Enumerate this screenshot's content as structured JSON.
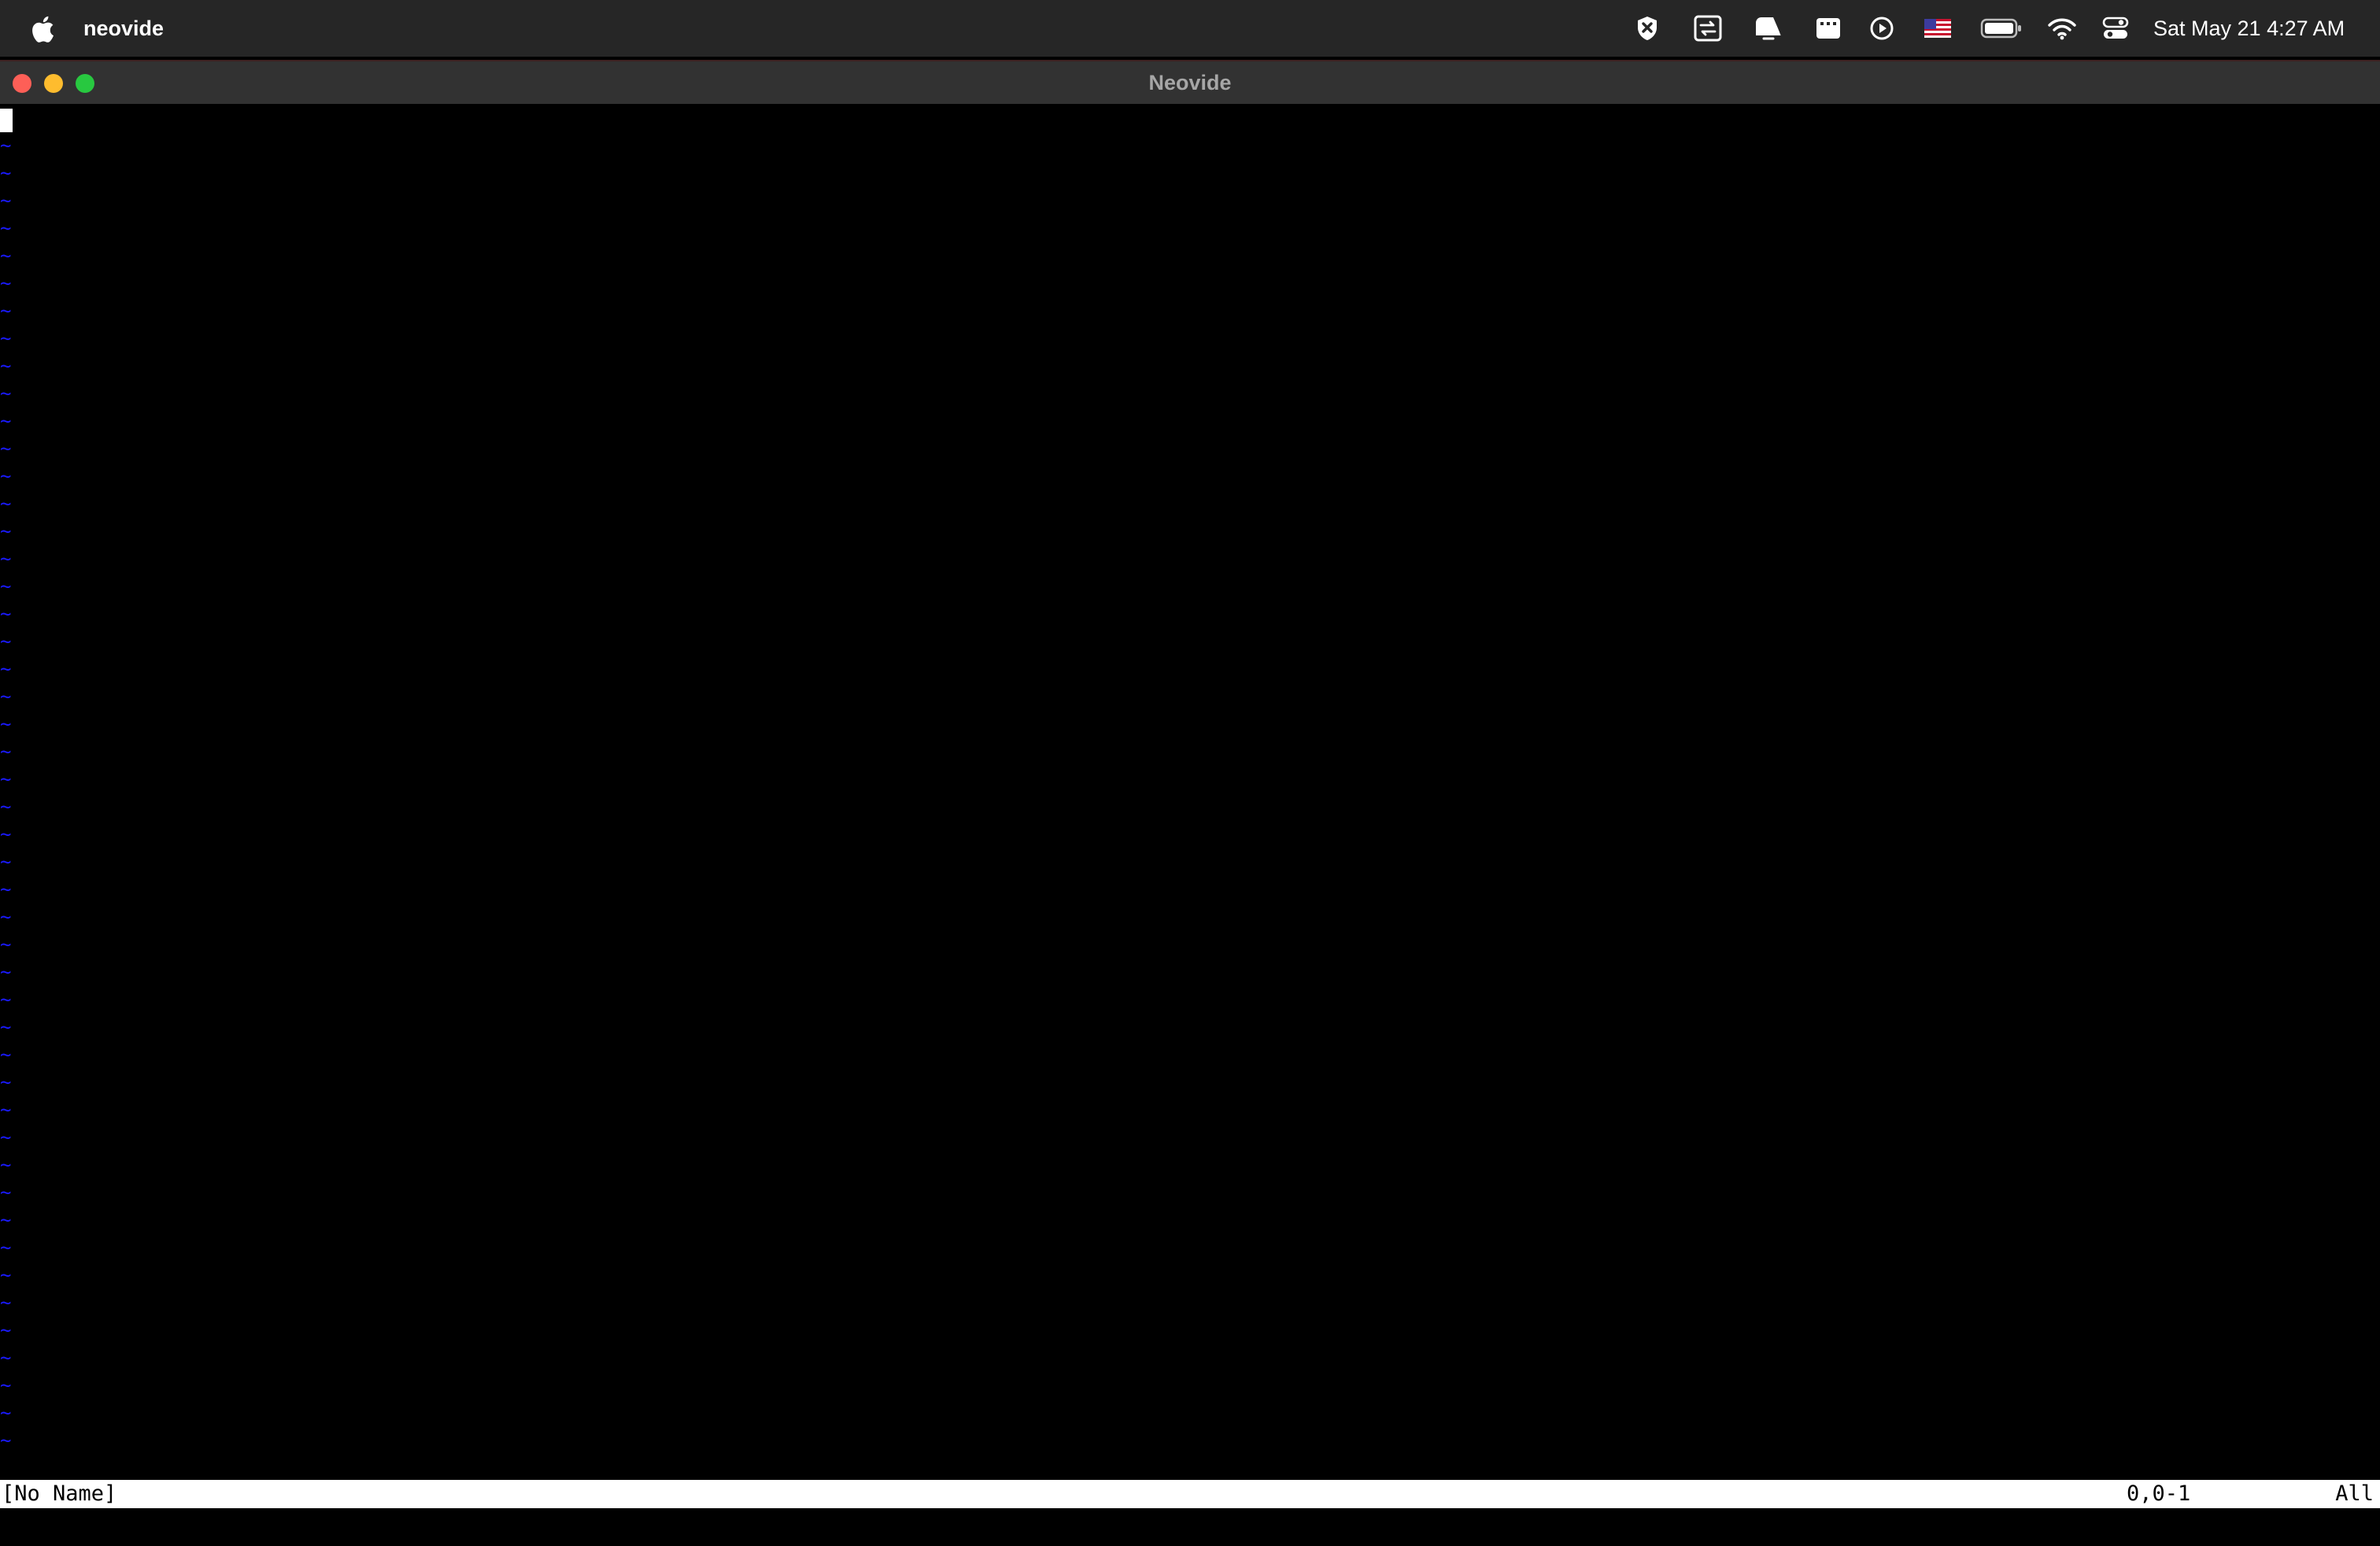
{
  "menubar": {
    "app_name": "neovide",
    "status_icons": [
      "shield-x-icon",
      "screen-share-icon",
      "notification-icon",
      "clipboard-icon",
      "play-icon",
      "us-flag-icon",
      "battery-icon",
      "wifi-icon",
      "control-center-icon"
    ],
    "clock": "Sat May 21  4:27 AM"
  },
  "window": {
    "title": "Neovide"
  },
  "editor": {
    "empty_line_marker": "~",
    "colors": {
      "background": "#000000",
      "tilde": "#1a1aff",
      "cursor": "#ffffff"
    }
  },
  "statusline": {
    "buffer_name": "[No Name]",
    "cursor_position": "0,0-1",
    "scroll_position": "All"
  }
}
